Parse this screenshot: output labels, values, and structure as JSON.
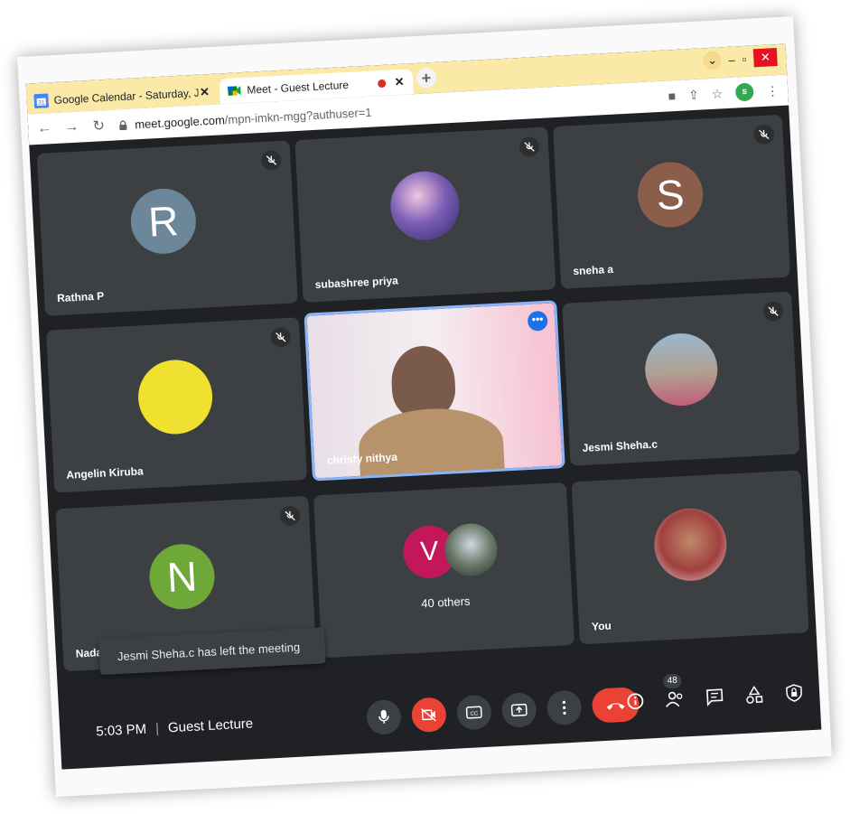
{
  "browser": {
    "tabs": [
      {
        "label": "Google Calendar - Saturday, Janu",
        "close": "✕"
      },
      {
        "label": "Meet - Guest Lecture",
        "close": "✕"
      }
    ],
    "new_tab": "+",
    "url_host": "meet.google.com",
    "url_path": "/mpn-imkn-mgg?authuser=1",
    "profile_initial": "s"
  },
  "tiles": [
    {
      "name": "Rathna P",
      "initial": "R",
      "avatar_color": "#6c8799",
      "muted": true
    },
    {
      "name": "subashree priya",
      "avatar": "landscape-photo",
      "muted": true
    },
    {
      "name": "sneha a",
      "initial": "S",
      "avatar_color": "#8b5e4c",
      "muted": true
    },
    {
      "name": "Angelin Kiruba",
      "avatar_color": "#f0e030",
      "muted": true
    },
    {
      "name": "christy nithya",
      "avatar": "video-feed",
      "muted": false
    },
    {
      "name": "Jesmi Sheha.c",
      "avatar": "group-photo",
      "muted": true
    },
    {
      "name": "Nadanasabai Ranganathan",
      "initial": "N",
      "avatar_color": "#6ea838",
      "muted": true
    },
    {
      "name": "40 others",
      "initial": "V",
      "avatar_color": "#c2185b"
    },
    {
      "name": "You",
      "avatar": "self-photo"
    }
  ],
  "toast": "Jesmi Sheha.c has left the meeting",
  "meeting": {
    "time": "5:03 PM",
    "separator": "|",
    "title": "Guest Lecture"
  },
  "people_count": "48",
  "colors": {
    "end_call": "#ea4335",
    "tile_bg": "#3c4043",
    "background": "#202124",
    "active_speaker": "#8ab4f8"
  }
}
